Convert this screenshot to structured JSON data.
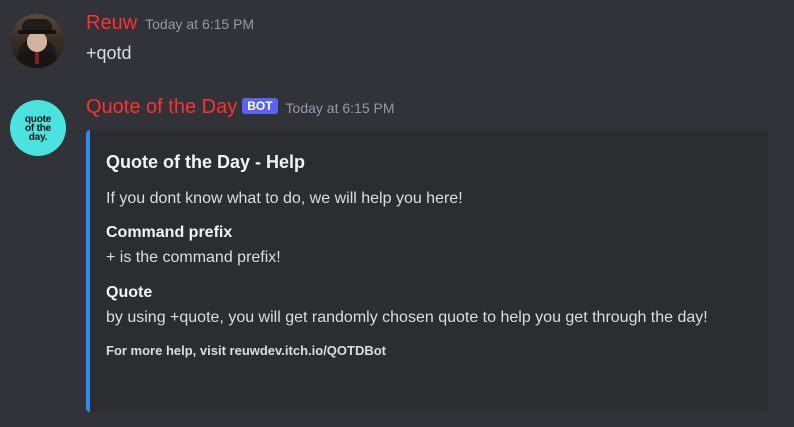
{
  "messages": [
    {
      "username": "Reuw",
      "timestamp": "Today at 6:15 PM",
      "text": "+qotd"
    },
    {
      "username": "Quote of the Day",
      "bot_tag": "BOT",
      "timestamp": "Today at 6:15 PM",
      "avatar_lines": [
        "quote",
        "of the",
        "day."
      ],
      "embed": {
        "title": "Quote of the Day - Help",
        "description": "If you dont know what to do, we will help you here!",
        "fields": [
          {
            "name": "Command prefix",
            "value": "+ is the command prefix!"
          },
          {
            "name": "Quote",
            "value": "by using +quote, you will get randomly chosen quote to help you get through the day!"
          }
        ],
        "footer": "For more help, visit reuwdev.itch.io/QOTDBot",
        "accent_color": "#2d8cf0"
      }
    }
  ],
  "colors": {
    "background": "#313338",
    "embed_background": "#2b2d31",
    "username": "#ff3030",
    "bot_tag": "#5865f2",
    "timestamp": "#949ba4"
  }
}
